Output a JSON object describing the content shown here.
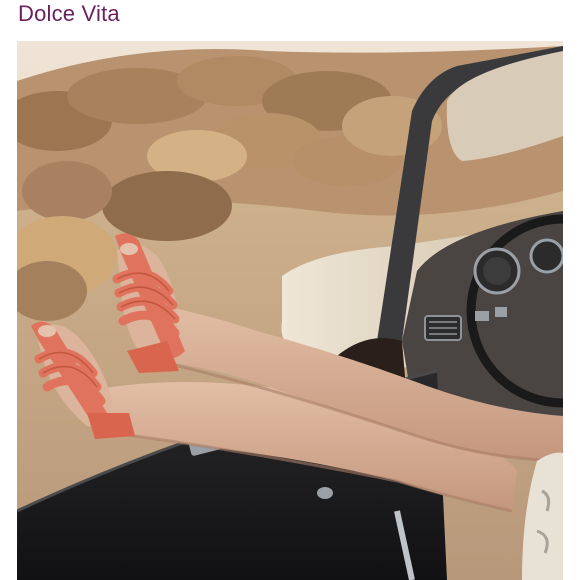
{
  "header": {
    "brand": "Dolce Vita"
  },
  "photo": {
    "subject": "legs-in-coral-sandals-out-of-convertible",
    "palette": {
      "sky": "#e9dccd",
      "ground": "#c7a885",
      "shrub": "#a7825c",
      "shrub_light": "#d9b98f",
      "car_black": "#1c1c1e",
      "car_cream": "#e6dac6",
      "skin": "#d9b49b",
      "skin_shadow": "#b98e76",
      "sandal": "#e0735d",
      "sandal_dark": "#c4563f",
      "chrome": "#9aa0a6"
    }
  }
}
